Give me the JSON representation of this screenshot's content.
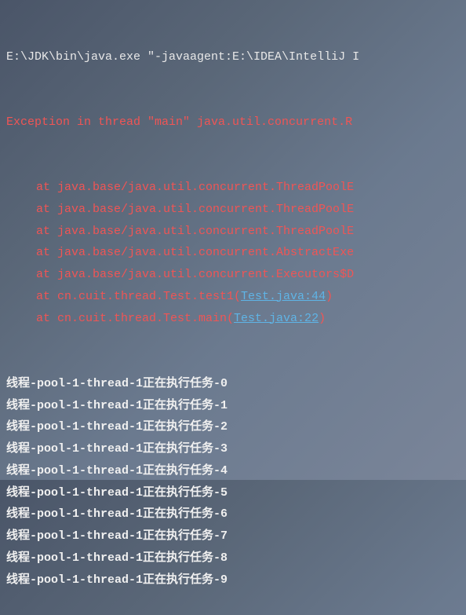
{
  "command": "E:\\JDK\\bin\\java.exe \"-javaagent:E:\\IDEA\\IntelliJ I",
  "exception": "Exception in thread \"main\" java.util.concurrent.R",
  "stack": [
    {
      "prefix": "at java.base/java.util.concurrent.ThreadPoolE"
    },
    {
      "prefix": "at java.base/java.util.concurrent.ThreadPoolE"
    },
    {
      "prefix": "at java.base/java.util.concurrent.ThreadPoolE"
    },
    {
      "prefix": "at java.base/java.util.concurrent.AbstractExe"
    },
    {
      "prefix": "at java.base/java.util.concurrent.Executors$D"
    },
    {
      "prefix": "at cn.cuit.thread.Test.test1(",
      "link": "Test.java:44",
      "suffix": ")"
    },
    {
      "prefix": "at cn.cuit.thread.Test.main(",
      "link": "Test.java:22",
      "suffix": ")"
    }
  ],
  "output": [
    "线程-pool-1-thread-1正在执行任务-0",
    "线程-pool-1-thread-1正在执行任务-1",
    "线程-pool-1-thread-1正在执行任务-2",
    "线程-pool-1-thread-1正在执行任务-3",
    "线程-pool-1-thread-1正在执行任务-4",
    "线程-pool-1-thread-1正在执行任务-5",
    "线程-pool-1-thread-1正在执行任务-6",
    "线程-pool-1-thread-1正在执行任务-7",
    "线程-pool-1-thread-1正在执行任务-8",
    "线程-pool-1-thread-1正在执行任务-9"
  ]
}
